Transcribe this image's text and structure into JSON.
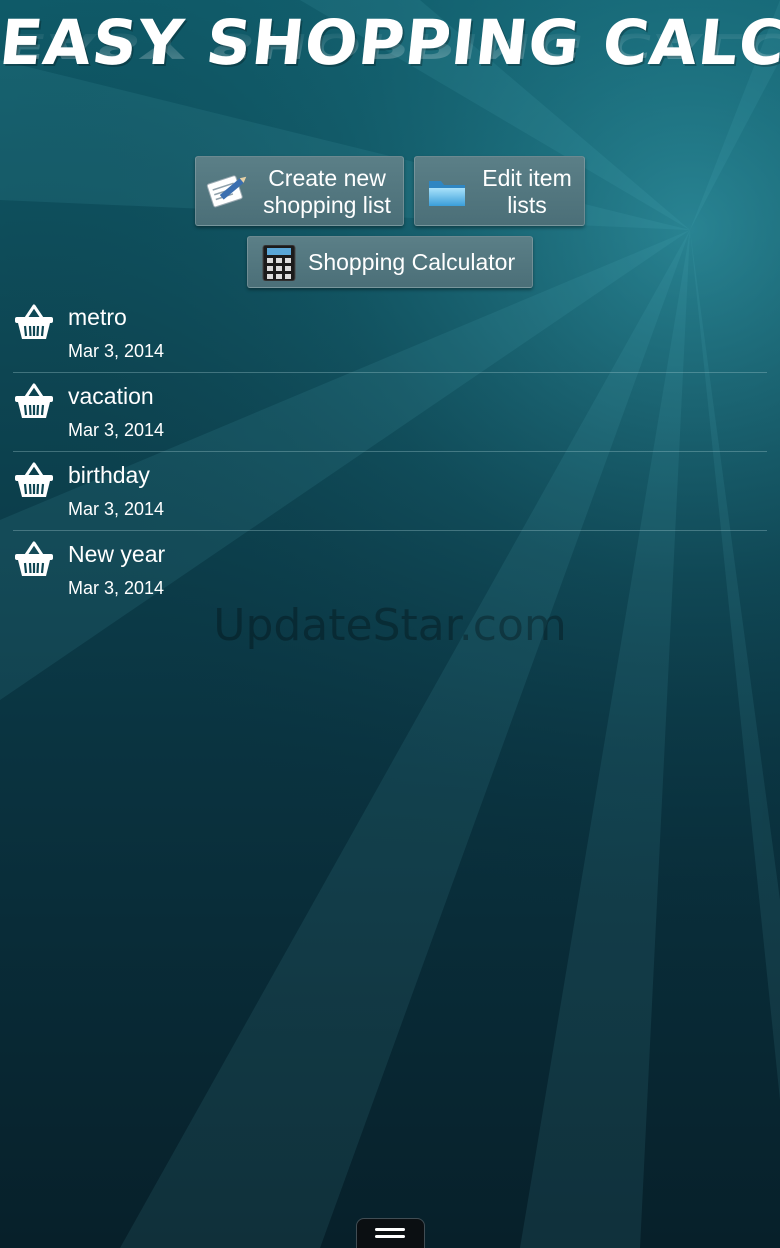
{
  "app": {
    "title": "EASY SHOPPING CALCULATOR"
  },
  "actions": {
    "create_list_label": "Create new shopping list",
    "edit_items_label": "Edit item lists",
    "calculator_label": "Shopping Calculator"
  },
  "shopping_lists": [
    {
      "name": "metro",
      "date": "Mar 3, 2014",
      "icon": "basket-icon"
    },
    {
      "name": "vacation",
      "date": "Mar 3, 2014",
      "icon": "basket-icon"
    },
    {
      "name": "birthday",
      "date": "Mar 3, 2014",
      "icon": "basket-icon"
    },
    {
      "name": "New year",
      "date": "Mar 3, 2014",
      "icon": "basket-icon"
    }
  ],
  "watermark": "UpdateStar.com",
  "icons": {
    "create": "notepad-pencil-icon",
    "edit": "folder-icon",
    "calculator": "calculator-icon",
    "menu": "menu-icon"
  },
  "colors": {
    "background_top": "#0f5a68",
    "background_bottom": "#07202a",
    "button": "#4f737c",
    "divider": "#a0c8cd"
  }
}
